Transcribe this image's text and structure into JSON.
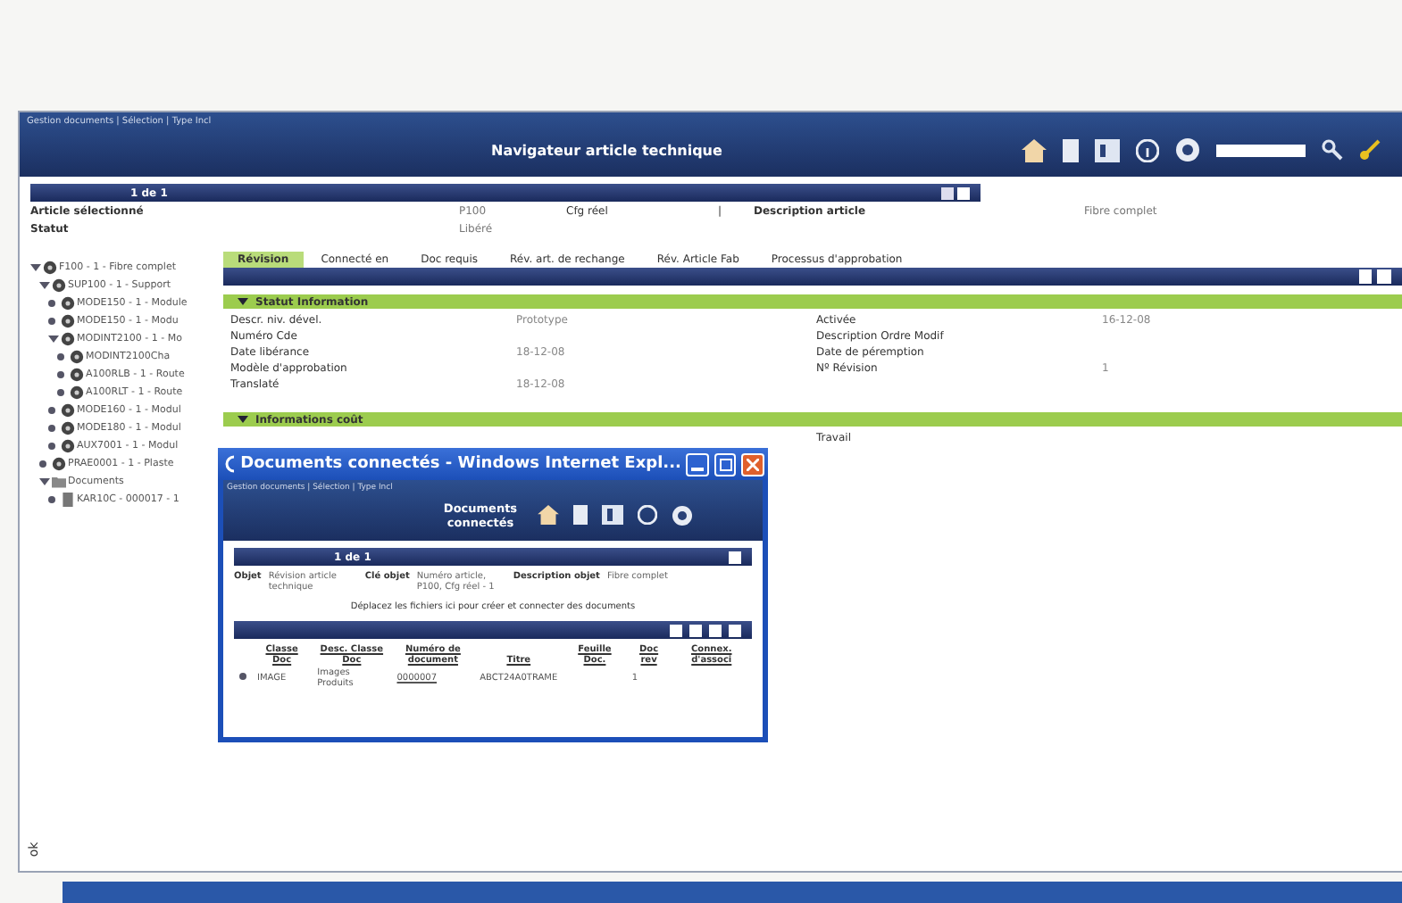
{
  "header": {
    "breadcrumb": "Gestion documents | Sélection | Type Incl",
    "title": "Navigateur article technique"
  },
  "summary": {
    "pager": "1 de 1",
    "rows": [
      {
        "label": "Article sélectionné",
        "value": "P100",
        "label_2": "Cfg réel",
        "sep": "|",
        "label_3": "Description article",
        "value_3": "Fibre complet"
      },
      {
        "label": "Statut",
        "value": "Libéré"
      }
    ]
  },
  "tree": [
    {
      "label": "F100 - 1 - Fibre complet",
      "expanded": true,
      "children": [
        {
          "label": "SUP100 - 1 - Support",
          "expanded": true,
          "children": [
            {
              "label": "MODE150 - 1 - Module"
            },
            {
              "label": "MODE150 - 1 - Modu"
            },
            {
              "label": "MODINT2100 - 1 - Mo",
              "expanded": true,
              "children": [
                {
                  "label": "MODINT2100Cha"
                },
                {
                  "label": "A100RLB - 1 - Route"
                },
                {
                  "label": "A100RLT - 1 - Route"
                }
              ]
            },
            {
              "label": "MODE160 - 1 - Modul"
            },
            {
              "label": "MODE180 - 1 - Modul"
            },
            {
              "label": "AUX7001 - 1 - Modul"
            }
          ]
        },
        {
          "label": "PRAE0001 - 1 - Plaste"
        },
        {
          "label": "Documents",
          "kind": "folder",
          "expanded": true,
          "children": [
            {
              "label": "KAR10C - 000017 - 1",
              "kind": "document"
            }
          ]
        }
      ]
    }
  ],
  "tabs": [
    {
      "label": "Révision",
      "selected": true
    },
    {
      "label": "Connecté en",
      "selected": false
    },
    {
      "label": "Doc requis",
      "selected": false
    },
    {
      "label": "Rév. art. de rechange",
      "selected": false
    },
    {
      "label": "Rév. Article Fab",
      "selected": false
    },
    {
      "label": "Processus d'approbation",
      "selected": false
    }
  ],
  "sections": [
    {
      "title": "Statut Information",
      "expanded": true,
      "left": [
        {
          "label": "Descr. niv. dével.",
          "value": "Prototype"
        },
        {
          "label": "Numéro Cde"
        },
        {
          "label": "Date libérance",
          "value": "18-12-08"
        },
        {
          "label": "Modèle d'approbation"
        },
        {
          "label": "Translaté",
          "value": "18-12-08"
        }
      ],
      "right": [
        {
          "label": "Activée",
          "value": "16-12-08"
        },
        {
          "label": "Description Ordre Modif"
        },
        {
          "label": "Date de péremption"
        },
        {
          "label": "Nº Révision",
          "value": "1"
        }
      ]
    },
    {
      "title": "Informations coût",
      "expanded": true,
      "right": [
        {
          "label": "Travail"
        }
      ]
    }
  ],
  "popup": {
    "title": "Documents connectés - Windows Internet Expl...",
    "breadcrumb": "Gestion documents | Sélection | Type Incl",
    "heading": "Documents connectés",
    "pager": "1 de 1",
    "object": [
      {
        "label": "Objet",
        "value": "Révision article technique"
      },
      {
        "label": "Clé objet",
        "value": "Numéro article, P100, Cfg réel - 1"
      },
      {
        "label": "Description objet",
        "value": "Fibre complet"
      }
    ],
    "drop_hint": "Déplacez les fichiers ici pour créer et connecter des documents",
    "columns": [
      "Classe Doc",
      "Desc. Classe Doc",
      "Numéro de document",
      "Titre",
      "Feuille Doc.",
      "Doc rev",
      "Connex. d'associ"
    ],
    "rows": [
      [
        "IMAGE",
        "Images Produits",
        "0000007",
        "ABCT24A0TRAME",
        null,
        "1",
        null
      ]
    ]
  },
  "corner_label": "ok"
}
